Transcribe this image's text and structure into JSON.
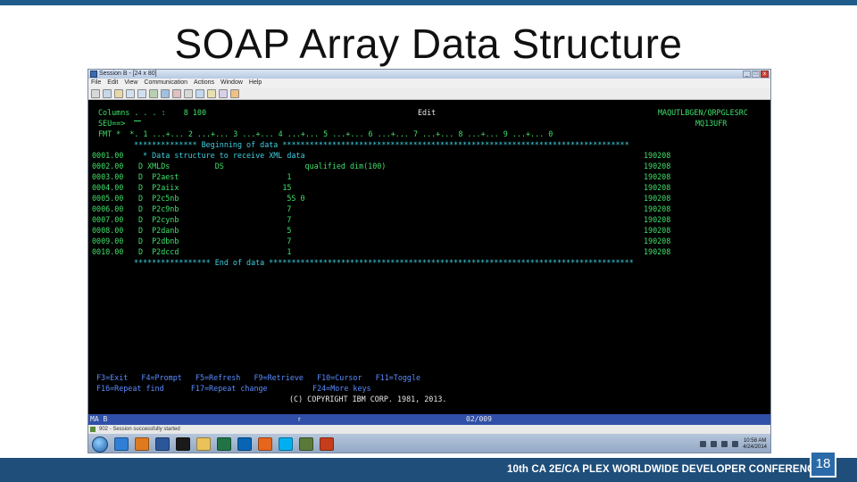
{
  "slide": {
    "title": "SOAP Array Data Structure",
    "footer": "10th CA 2E/CA PLEX WORLDWIDE DEVELOPER CONFERENCE",
    "page_number": "18",
    "colors": {
      "top_bar": "#1f5c8c",
      "footer_band": "#1f4e7a",
      "badge": "#2a6aa8"
    }
  },
  "window": {
    "title": "Session B - [24 x 80]",
    "menu": [
      "File",
      "Edit",
      "View",
      "Communication",
      "Actions",
      "Window",
      "Help"
    ],
    "status_message": "902 - Session successfully started"
  },
  "terminal": {
    "header": {
      "columns": "Columns . . . :    8 100",
      "mode": "Edit",
      "source_file": "MAQUTLBGEN/QRPGLESRC",
      "sew": "SEU==>",
      "member": "MQ13UFR",
      "fmt": "FMT *  *. 1 ...+... 2 ...+... 3 ...+... 4 ...+... 5 ...+... 6 ...+... 7 ...+... 8 ...+... 9 ...+... 0"
    },
    "begin_marker": "************** Beginning of data *****************************************************************************",
    "end_marker": "***************** End of data *********************************************************************************",
    "rows": [
      {
        "seq": "0001.00",
        "src": " * Data structure to receive XML data",
        "date": "190208"
      },
      {
        "seq": "0002.00",
        "src": "D XMLDs          DS                  qualified dim(100)",
        "date": "190208"
      },
      {
        "seq": "0003.00",
        "src": "D  P2aest                        1",
        "date": "190208"
      },
      {
        "seq": "0004.00",
        "src": "D  P2aiix                       15",
        "date": "190208"
      },
      {
        "seq": "0005.00",
        "src": "D  P2c5nb                        5S 0",
        "date": "190208"
      },
      {
        "seq": "0006.00",
        "src": "D  P2c9nb                        7",
        "date": "190208"
      },
      {
        "seq": "0007.00",
        "src": "D  P2cynb                        7",
        "date": "190208"
      },
      {
        "seq": "0008.00",
        "src": "D  P2danb                        5",
        "date": "190208"
      },
      {
        "seq": "0009.00",
        "src": "D  P2dbnb                        7",
        "date": "190208"
      },
      {
        "seq": "0010.00",
        "src": "D  P2dccd                        1",
        "date": "190208"
      }
    ],
    "function_keys_1": "F3=Exit   F4=Prompt   F5=Refresh   F9=Retrieve   F10=Cursor   F11=Toggle",
    "function_keys_2": "F16=Repeat find      F17=Repeat change          F24=More keys",
    "copyright": "(C) COPYRIGHT IBM CORP. 1981, 2013.",
    "status_left": "MA    B",
    "status_mid": "⇑",
    "status_pos": "02/009"
  },
  "taskbar": {
    "icons": [
      {
        "name": "internet-explorer",
        "color": "#2f7fd6"
      },
      {
        "name": "media-player",
        "color": "#e07a1f"
      },
      {
        "name": "word",
        "color": "#2b579a"
      },
      {
        "name": "command-prompt",
        "color": "#1a1a1a"
      },
      {
        "name": "file-explorer",
        "color": "#e9c25a"
      },
      {
        "name": "excel",
        "color": "#217346"
      },
      {
        "name": "outlook",
        "color": "#0a64b4"
      },
      {
        "name": "firefox",
        "color": "#e6661e"
      },
      {
        "name": "skype",
        "color": "#00aff0"
      },
      {
        "name": "session-manager",
        "color": "#5a7a3a"
      },
      {
        "name": "powerpoint",
        "color": "#c43e1c"
      }
    ],
    "clock_time": "10:58 AM",
    "clock_date": "4/24/2014"
  }
}
